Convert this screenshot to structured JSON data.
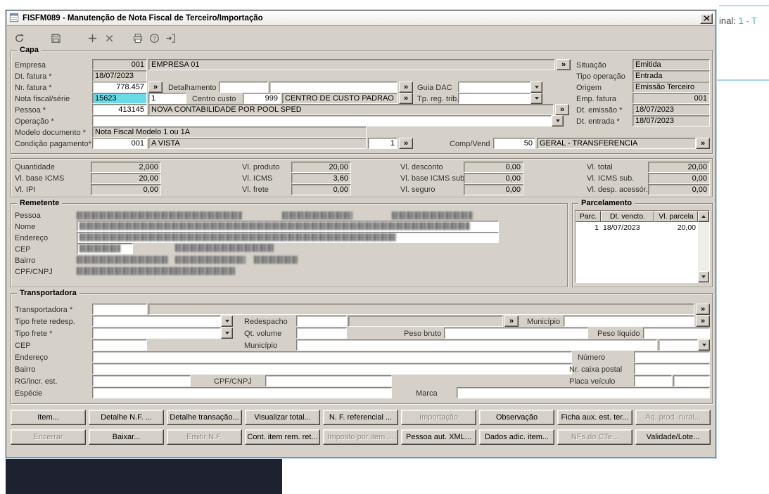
{
  "window": {
    "title": "FISFM089 - Manutenção de Nota Fiscal de Terceiro/Importação"
  },
  "desktop": {
    "terminal_fragment": "inal:",
    "terminal_value": "1 - T"
  },
  "ui": {
    "lookup": "»"
  },
  "colors": {
    "selection": "#68dbe9",
    "dialog_bg": "#d5d1c9",
    "terminal_accent": "#35b7c8",
    "dark_panel": "#1d2130"
  },
  "toolbar": {
    "icons": [
      "undo-icon",
      "save-icon",
      "new-icon",
      "delete-icon",
      "print-icon",
      "help-icon",
      "exit-icon"
    ]
  },
  "capa": {
    "legend": "Capa",
    "empresa_label": "Empresa",
    "empresa_code": "001",
    "empresa_name": "EMPRESA 01",
    "dt_fatura_label": "Dt. fatura *",
    "dt_fatura": "18/07/2023",
    "nr_fatura_label": "Nr. fatura *",
    "nr_fatura": "778.457",
    "detalhamento_label": "Detalhamento",
    "guia_dac_label": "Guia DAC",
    "nota_fiscal_label": "Nota fiscal/série",
    "nota_fiscal": "15623",
    "serie": "1",
    "centro_custo_label": "Centro custo",
    "centro_custo_code": "999",
    "centro_custo_name": "CENTRO DE CUSTO PADRAO",
    "tp_reg_trib_label": "Tp. reg. trib.",
    "pessoa_label": "Pessoa *",
    "pessoa_code": "413145",
    "pessoa_name": "NOVA CONTABILIDADE POR POOL SPED",
    "operacao_label": "Operação *",
    "modelo_label": "Modelo documento *",
    "modelo": "Nota Fiscal Modelo 1 ou 1A",
    "cond_pag_label": "Condição pagamento*",
    "cond_pag_code": "001",
    "cond_pag_name": "A VISTA",
    "cond_pag_parcelas": "1",
    "comp_vend_label": "Comp/Vend",
    "comp_vend_code": "50",
    "comp_vend_name": "GERAL - TRANSFERENCIA",
    "situacao_label": "Situação",
    "situacao": "Emitida",
    "tipo_operacao_label": "Tipo operação",
    "tipo_operacao": "Entrada",
    "origem_label": "Origem",
    "origem": "Emissão Terceiro",
    "emp_fatura_label": "Emp. fatura",
    "emp_fatura": "001",
    "dt_emissao_label": "Dt. emissão *",
    "dt_emissao": "18/07/2023",
    "dt_entrada_label": "Dt. entrada *",
    "dt_entrada": "18/07/2023"
  },
  "totais": {
    "fields": [
      {
        "label": "Quantidade",
        "value": "2,000"
      },
      {
        "label": "Vl. produto",
        "value": "20,00"
      },
      {
        "label": "Vl. desconto",
        "value": "0,00"
      },
      {
        "label": "Vl. total",
        "value": "20,00"
      },
      {
        "label": "Vl. base ICMS",
        "value": "20,00"
      },
      {
        "label": "Vl. ICMS",
        "value": "3,60"
      },
      {
        "label": "Vl. base ICMS sub.",
        "value": "0,00"
      },
      {
        "label": "Vl. ICMS sub.",
        "value": "0,00"
      },
      {
        "label": "Vl. IPI",
        "value": "0,00"
      },
      {
        "label": "Vl. frete",
        "value": "0,00"
      },
      {
        "label": "Vl. seguro",
        "value": "0,00"
      },
      {
        "label": "Vl. desp. acessór.",
        "value": "0,00"
      }
    ]
  },
  "remetente": {
    "legend": "Remetente",
    "labels": [
      "Pessoa",
      "Nome",
      "Endereço",
      "CEP",
      "Bairro",
      "CPF/CNPJ"
    ]
  },
  "parcelamento": {
    "legend": "Parcelamento",
    "columns": [
      "Parc.",
      "Dt. vencto.",
      "Vl. parcela"
    ],
    "rows": [
      [
        "1",
        "18/07/2023",
        "20,00"
      ]
    ]
  },
  "transportadora": {
    "legend": "Transportadora",
    "transportadora_label": "Transportadora *",
    "tipo_frete_redesp_label": "Tipo frete redesp.",
    "redespacho_label": "Redespacho",
    "municipio_redesp_label": "Município",
    "tipo_frete_label": "Tipo frete *",
    "qt_volume_label": "Qt. volume",
    "peso_bruto_label": "Peso bruto",
    "peso_liquido_label": "Peso líquido",
    "cep_label": "CEP",
    "municipio_label": "Município",
    "endereco_label": "Endereço",
    "numero_label": "Número",
    "bairro_label": "Bairro",
    "nr_caixa_postal_label": "Nr. caixa postal",
    "rg_incr_est_label": "RG/incr. est.",
    "cpf_cnpj_label": "CPF/CNPJ",
    "placa_veiculo_label": "Placa veículo",
    "especie_label": "Espécie",
    "marca_label": "Marca"
  },
  "buttons": {
    "row1": [
      {
        "label": "Item...",
        "disabled": false
      },
      {
        "label": "Detalhe N.F. ...",
        "disabled": false
      },
      {
        "label": "Detalhe transação...",
        "disabled": false
      },
      {
        "label": "Visualizar total...",
        "disabled": false
      },
      {
        "label": "N. F. referencial ...",
        "disabled": false
      },
      {
        "label": "Importação",
        "disabled": true
      },
      {
        "label": "Observação",
        "disabled": false
      },
      {
        "label": "Ficha aux. est. ter...",
        "disabled": false
      },
      {
        "label": "Aq. prod. rural...",
        "disabled": true
      }
    ],
    "row2": [
      {
        "label": "Encerrar",
        "disabled": true
      },
      {
        "label": "Baixar...",
        "disabled": false
      },
      {
        "label": "Emitir N.F.",
        "disabled": true
      },
      {
        "label": "Cont. item rem. ret...",
        "disabled": false
      },
      {
        "label": "Imposto por item ...",
        "disabled": true
      },
      {
        "label": "Pessoa aut. XML...",
        "disabled": false
      },
      {
        "label": "Dados adic. item...",
        "disabled": false
      },
      {
        "label": "NFs do CTe...",
        "disabled": true
      },
      {
        "label": "Validade/Lote...",
        "disabled": false
      }
    ]
  }
}
